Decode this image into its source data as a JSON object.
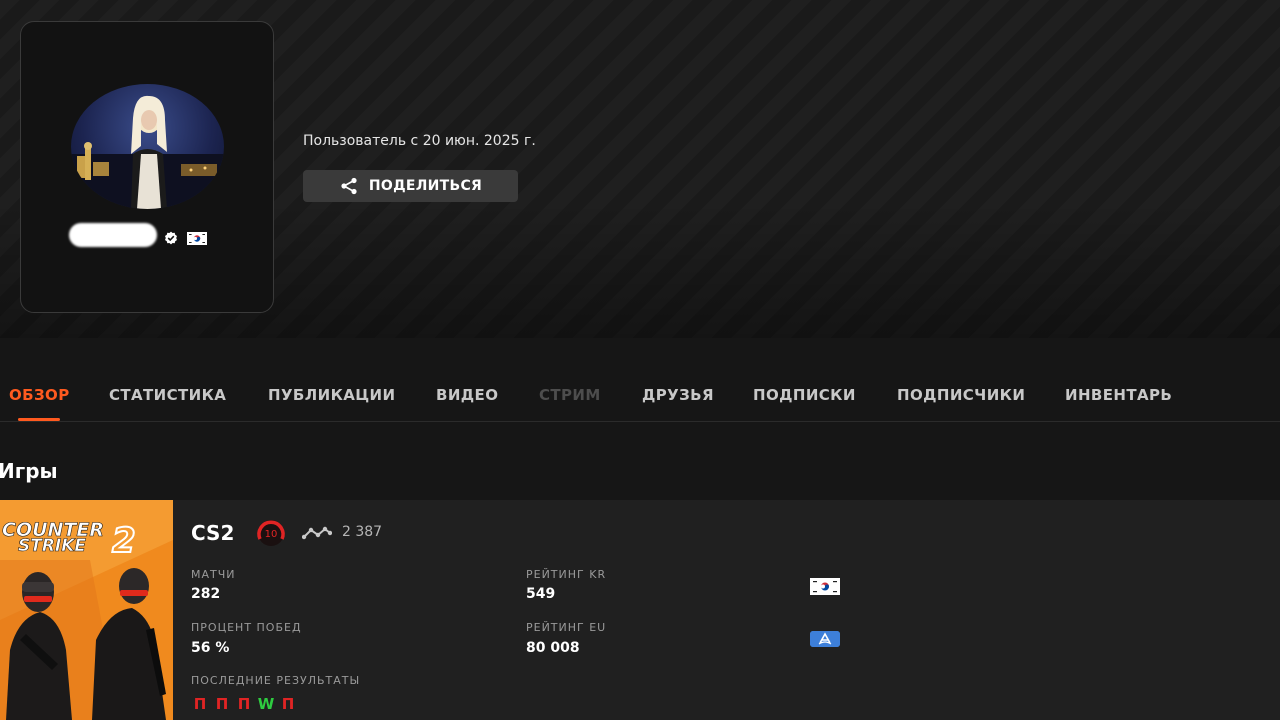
{
  "profile": {
    "member_since": "Пользователь с 20 июн. 2025 г.",
    "share_label": "ПОДЕЛИТЬСЯ"
  },
  "tabs": [
    {
      "label": "ОБЗОР",
      "state": "active"
    },
    {
      "label": "СТАТИСТИКА",
      "state": "normal"
    },
    {
      "label": "ПУБЛИКАЦИИ",
      "state": "normal"
    },
    {
      "label": "ВИДЕО",
      "state": "normal"
    },
    {
      "label": "СТРИМ",
      "state": "disabled"
    },
    {
      "label": "ДРУЗЬЯ",
      "state": "normal"
    },
    {
      "label": "ПОДПИСКИ",
      "state": "normal"
    },
    {
      "label": "ПОДПИСЧИКИ",
      "state": "normal"
    },
    {
      "label": "ИНВЕНТАРЬ",
      "state": "normal"
    }
  ],
  "games": {
    "title": "Игры",
    "cs2": {
      "cover_title_line1": "COUNTER",
      "cover_title_line2": "STRIKE",
      "cover_number": "2",
      "name": "CS2",
      "level": "10",
      "elo": "2 387",
      "matches_label": "МАТЧИ",
      "matches_value": "282",
      "winrate_label": "ПРОЦЕНТ ПОБЕД",
      "winrate_value": "56 %",
      "rating_kr_label": "РЕЙТИНГ KR",
      "rating_kr_value": "549",
      "rating_eu_label": "РЕЙТИНГ EU",
      "rating_eu_value": "80 008",
      "recent_label": "ПОСЛЕДНИЕ РЕЗУЛЬТАТЫ",
      "recent_results": [
        "П",
        "П",
        "П",
        "W",
        "П"
      ]
    }
  },
  "colors": {
    "accent": "#ff5a1f",
    "win": "#2ecc40",
    "loss": "#e02424",
    "level_badge": "#e02424"
  },
  "icons": {
    "share": "share-icon",
    "verified": "verified-icon",
    "elo": "elo-graph-icon",
    "flag_kr": "south-korea-flag-icon",
    "flag_eu": "eu-region-icon"
  }
}
